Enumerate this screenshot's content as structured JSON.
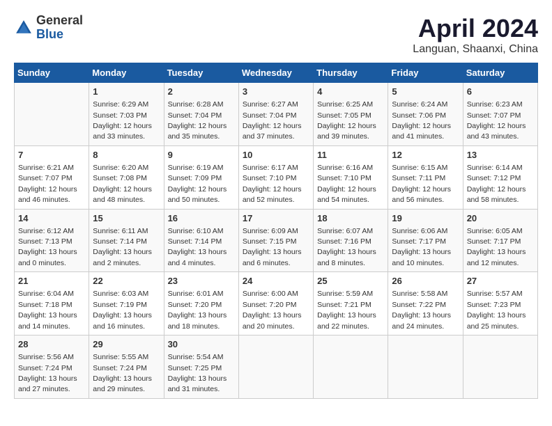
{
  "header": {
    "logo_general": "General",
    "logo_blue": "Blue",
    "title": "April 2024",
    "subtitle": "Languan, Shaanxi, China"
  },
  "days_of_week": [
    "Sunday",
    "Monday",
    "Tuesday",
    "Wednesday",
    "Thursday",
    "Friday",
    "Saturday"
  ],
  "weeks": [
    [
      {
        "day": "",
        "info": ""
      },
      {
        "day": "1",
        "info": "Sunrise: 6:29 AM\nSunset: 7:03 PM\nDaylight: 12 hours\nand 33 minutes."
      },
      {
        "day": "2",
        "info": "Sunrise: 6:28 AM\nSunset: 7:04 PM\nDaylight: 12 hours\nand 35 minutes."
      },
      {
        "day": "3",
        "info": "Sunrise: 6:27 AM\nSunset: 7:04 PM\nDaylight: 12 hours\nand 37 minutes."
      },
      {
        "day": "4",
        "info": "Sunrise: 6:25 AM\nSunset: 7:05 PM\nDaylight: 12 hours\nand 39 minutes."
      },
      {
        "day": "5",
        "info": "Sunrise: 6:24 AM\nSunset: 7:06 PM\nDaylight: 12 hours\nand 41 minutes."
      },
      {
        "day": "6",
        "info": "Sunrise: 6:23 AM\nSunset: 7:07 PM\nDaylight: 12 hours\nand 43 minutes."
      }
    ],
    [
      {
        "day": "7",
        "info": "Sunrise: 6:21 AM\nSunset: 7:07 PM\nDaylight: 12 hours\nand 46 minutes."
      },
      {
        "day": "8",
        "info": "Sunrise: 6:20 AM\nSunset: 7:08 PM\nDaylight: 12 hours\nand 48 minutes."
      },
      {
        "day": "9",
        "info": "Sunrise: 6:19 AM\nSunset: 7:09 PM\nDaylight: 12 hours\nand 50 minutes."
      },
      {
        "day": "10",
        "info": "Sunrise: 6:17 AM\nSunset: 7:10 PM\nDaylight: 12 hours\nand 52 minutes."
      },
      {
        "day": "11",
        "info": "Sunrise: 6:16 AM\nSunset: 7:10 PM\nDaylight: 12 hours\nand 54 minutes."
      },
      {
        "day": "12",
        "info": "Sunrise: 6:15 AM\nSunset: 7:11 PM\nDaylight: 12 hours\nand 56 minutes."
      },
      {
        "day": "13",
        "info": "Sunrise: 6:14 AM\nSunset: 7:12 PM\nDaylight: 12 hours\nand 58 minutes."
      }
    ],
    [
      {
        "day": "14",
        "info": "Sunrise: 6:12 AM\nSunset: 7:13 PM\nDaylight: 13 hours\nand 0 minutes."
      },
      {
        "day": "15",
        "info": "Sunrise: 6:11 AM\nSunset: 7:14 PM\nDaylight: 13 hours\nand 2 minutes."
      },
      {
        "day": "16",
        "info": "Sunrise: 6:10 AM\nSunset: 7:14 PM\nDaylight: 13 hours\nand 4 minutes."
      },
      {
        "day": "17",
        "info": "Sunrise: 6:09 AM\nSunset: 7:15 PM\nDaylight: 13 hours\nand 6 minutes."
      },
      {
        "day": "18",
        "info": "Sunrise: 6:07 AM\nSunset: 7:16 PM\nDaylight: 13 hours\nand 8 minutes."
      },
      {
        "day": "19",
        "info": "Sunrise: 6:06 AM\nSunset: 7:17 PM\nDaylight: 13 hours\nand 10 minutes."
      },
      {
        "day": "20",
        "info": "Sunrise: 6:05 AM\nSunset: 7:17 PM\nDaylight: 13 hours\nand 12 minutes."
      }
    ],
    [
      {
        "day": "21",
        "info": "Sunrise: 6:04 AM\nSunset: 7:18 PM\nDaylight: 13 hours\nand 14 minutes."
      },
      {
        "day": "22",
        "info": "Sunrise: 6:03 AM\nSunset: 7:19 PM\nDaylight: 13 hours\nand 16 minutes."
      },
      {
        "day": "23",
        "info": "Sunrise: 6:01 AM\nSunset: 7:20 PM\nDaylight: 13 hours\nand 18 minutes."
      },
      {
        "day": "24",
        "info": "Sunrise: 6:00 AM\nSunset: 7:20 PM\nDaylight: 13 hours\nand 20 minutes."
      },
      {
        "day": "25",
        "info": "Sunrise: 5:59 AM\nSunset: 7:21 PM\nDaylight: 13 hours\nand 22 minutes."
      },
      {
        "day": "26",
        "info": "Sunrise: 5:58 AM\nSunset: 7:22 PM\nDaylight: 13 hours\nand 24 minutes."
      },
      {
        "day": "27",
        "info": "Sunrise: 5:57 AM\nSunset: 7:23 PM\nDaylight: 13 hours\nand 25 minutes."
      }
    ],
    [
      {
        "day": "28",
        "info": "Sunrise: 5:56 AM\nSunset: 7:24 PM\nDaylight: 13 hours\nand 27 minutes."
      },
      {
        "day": "29",
        "info": "Sunrise: 5:55 AM\nSunset: 7:24 PM\nDaylight: 13 hours\nand 29 minutes."
      },
      {
        "day": "30",
        "info": "Sunrise: 5:54 AM\nSunset: 7:25 PM\nDaylight: 13 hours\nand 31 minutes."
      },
      {
        "day": "",
        "info": ""
      },
      {
        "day": "",
        "info": ""
      },
      {
        "day": "",
        "info": ""
      },
      {
        "day": "",
        "info": ""
      }
    ]
  ]
}
